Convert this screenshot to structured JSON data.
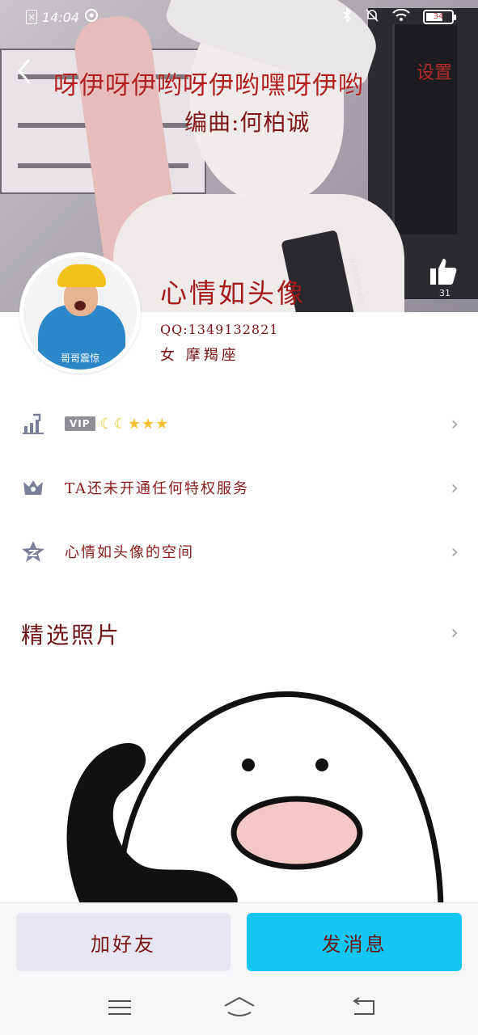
{
  "status_bar": {
    "time": "14:04",
    "battery_level": "34"
  },
  "cover": {
    "title": "呀伊呀伊哟呀伊哟嘿呀伊哟",
    "subtitle": "编曲:何柏诚",
    "settings_label": "设置",
    "nickname": "心情如头像",
    "like_count": "31",
    "strap_text": "passionate"
  },
  "avatar": {
    "caption": "哥哥震惊"
  },
  "profile": {
    "qq": "QQ:1349132821",
    "gender_sign": "女  摩羯座"
  },
  "rows": [
    {
      "icon": "level-up-icon",
      "label": "VIP",
      "levels": "🌙🌙⭐⭐⭐"
    },
    {
      "icon": "crown-icon",
      "label": "TA还未开通任何特权服务"
    },
    {
      "icon": "qzone-star-icon",
      "label": "心情如头像的空间"
    }
  ],
  "featured": {
    "title": "精选照片"
  },
  "actions": {
    "add_friend": "加好友",
    "send_message": "发消息"
  },
  "colors": {
    "accent_text": "#8b1a1a",
    "message_button": "#12c7f3",
    "add_button": "#e6e7f1"
  }
}
